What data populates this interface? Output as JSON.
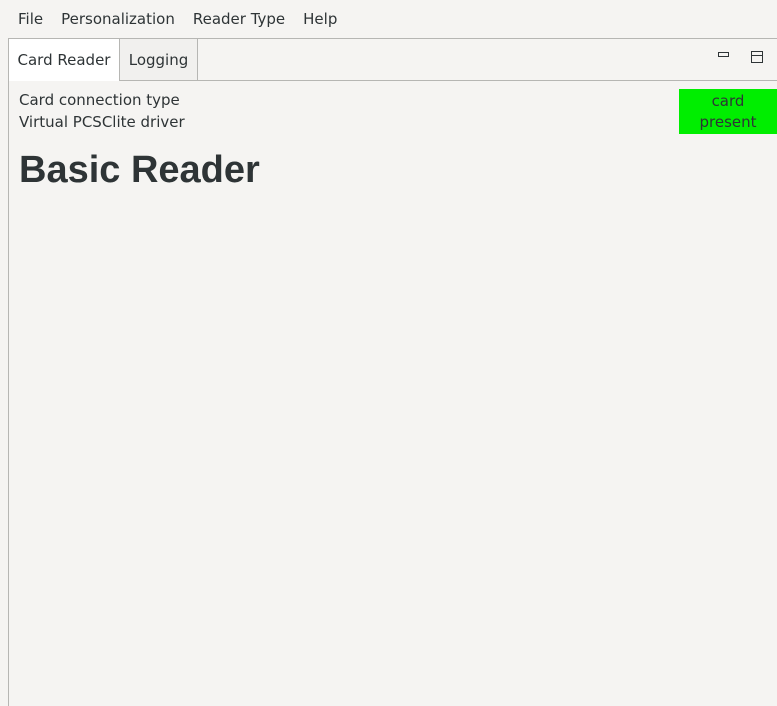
{
  "menubar": {
    "items": [
      "File",
      "Personalization",
      "Reader Type",
      "Help"
    ]
  },
  "tabs": {
    "items": [
      {
        "label": "Card Reader",
        "active": true
      },
      {
        "label": "Logging",
        "active": false
      }
    ]
  },
  "panel": {
    "connection_type_label": "Card connection type",
    "driver_label": "Virtual PCSClite driver",
    "status": {
      "line1": "card",
      "line2": "present",
      "color": "#00ee00"
    },
    "title": "Basic Reader"
  },
  "icons": {
    "dock_minimize": "minimize-icon",
    "dock_float": "float-icon"
  }
}
